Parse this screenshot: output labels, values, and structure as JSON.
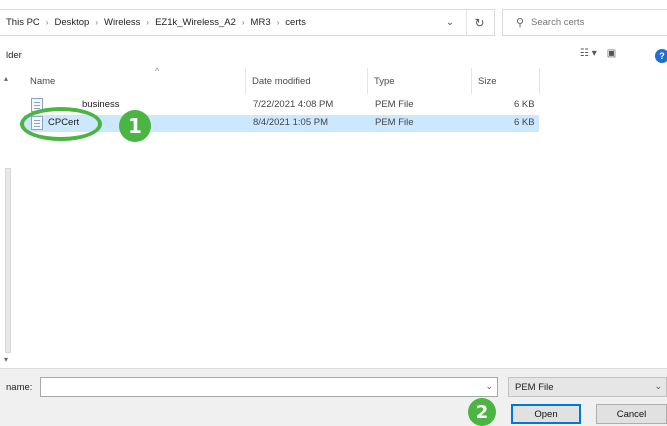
{
  "address": {
    "crumbs": [
      "This PC",
      "Desktop",
      "Wireless",
      "EZ1k_Wireless_A2",
      "MR3",
      "certs"
    ],
    "dropdown_icon": "chevron-down-icon",
    "refresh_icon": "refresh-icon"
  },
  "search": {
    "placeholder": "Search certs"
  },
  "toolbar": {
    "folder_label": "lder"
  },
  "columns": {
    "name": "Name",
    "date": "Date modified",
    "type": "Type",
    "size": "Size"
  },
  "files": [
    {
      "name": "business",
      "date": "7/22/2021 4:08 PM",
      "type": "PEM File",
      "size": "6 KB",
      "selected": false
    },
    {
      "name": "CPCert",
      "date": "8/4/2021 1:05 PM",
      "type": "PEM File",
      "size": "6 KB",
      "selected": true
    }
  ],
  "annotations": {
    "step1": "1",
    "step2": "2",
    "highlight_color": "#4bb543"
  },
  "bottom": {
    "file_name_label": "name:",
    "file_name_value": "",
    "file_type": "PEM File",
    "open_label": "Open",
    "cancel_label": "Cancel"
  }
}
